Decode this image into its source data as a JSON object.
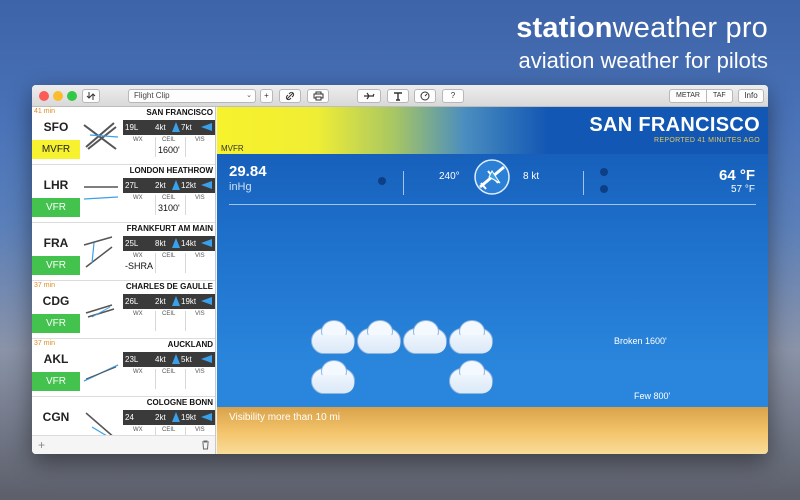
{
  "hero": {
    "title_bold": "station",
    "title_rest": "weather pro",
    "subtitle": "aviation weather for pilots"
  },
  "colors": {
    "vfr": "#43c24e",
    "mvfr": "#f7f230",
    "wind_arrow": "#3aa0ea",
    "age": "#e08a1e"
  },
  "toolbar": {
    "select_value": "Flight Clip",
    "add_label": "+",
    "segments": [
      "METAR",
      "TAF"
    ],
    "info_label": "Info",
    "icons": [
      "download-icon",
      "chevron-down-icon",
      "plus-icon",
      "link-icon",
      "print-icon",
      "plane-icon",
      "tower-icon",
      "gauge-icon",
      "question-icon"
    ]
  },
  "labels": {
    "wx": "WX",
    "ceil": "CEIL",
    "vis": "VIS"
  },
  "stations": [
    {
      "code": "SFO",
      "name": "SAN FRANCISCO",
      "age": "41 min",
      "category": "MVFR",
      "runway": "19L",
      "wind": "4kt",
      "gust": "7kt",
      "wx": "",
      "ceil": "1600'",
      "vis": ""
    },
    {
      "code": "LHR",
      "name": "LONDON HEATHROW",
      "age": "",
      "category": "VFR",
      "runway": "27L",
      "wind": "2kt",
      "gust": "12kt",
      "wx": "",
      "ceil": "3100'",
      "vis": ""
    },
    {
      "code": "FRA",
      "name": "FRANKFURT AM MAIN",
      "age": "",
      "category": "VFR",
      "runway": "25L",
      "wind": "8kt",
      "gust": "14kt",
      "wx": "-SHRA",
      "ceil": "",
      "vis": ""
    },
    {
      "code": "CDG",
      "name": "CHARLES DE GAULLE",
      "age": "37 min",
      "category": "VFR",
      "runway": "26L",
      "wind": "2kt",
      "gust": "19kt",
      "wx": "",
      "ceil": "",
      "vis": ""
    },
    {
      "code": "AKL",
      "name": "AUCKLAND",
      "age": "37 min",
      "category": "VFR",
      "runway": "23L",
      "wind": "4kt",
      "gust": "5kt",
      "wx": "",
      "ceil": "",
      "vis": ""
    },
    {
      "code": "CGN",
      "name": "COLOGNE BONN",
      "age": "",
      "category": "",
      "runway": "24",
      "wind": "2kt",
      "gust": "19kt",
      "wx": "",
      "ceil": "",
      "vis": ""
    }
  ],
  "sidebar_footer": {
    "add": "+",
    "trash_icon": "trash-icon"
  },
  "main": {
    "category": "MVFR",
    "station_name": "SAN FRANCISCO",
    "reported": "REPORTED 41 MINUTES AGO",
    "pressure": "29.84",
    "pressure_unit": "inHg",
    "wind_dir": "240°",
    "wind_speed": "8 kt",
    "temp": "64 °F",
    "dew": "57 °F",
    "layers": [
      {
        "label": "Broken 1600'",
        "clouds": 4
      },
      {
        "label": "Few 800'",
        "clouds": 2
      }
    ],
    "visibility": "Visibility more than 10 mi"
  }
}
